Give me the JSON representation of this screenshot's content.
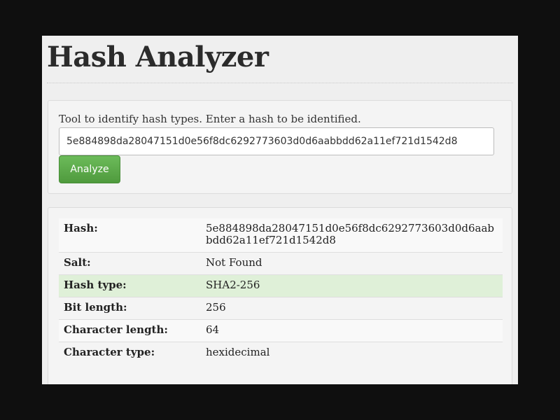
{
  "page": {
    "title": "Hash Analyzer"
  },
  "form": {
    "instructions": "Tool to identify hash types. Enter a hash to be identified.",
    "hash_value": "5e884898da28047151d0e56f8dc6292773603d0d6aabbdd62a11ef721d1542d8",
    "analyze_label": "Analyze",
    "button_color": "#5cb85c"
  },
  "result": {
    "highlight_color": "#dff0d8",
    "rows": [
      {
        "label": "Hash:",
        "value": "5e884898da28047151d0e56f8dc6292773603d0d6aabbdd62a11ef721d1542d8"
      },
      {
        "label": "Salt:",
        "value": "Not Found"
      },
      {
        "label": "Hash type:",
        "value": "SHA2-256"
      },
      {
        "label": "Bit length:",
        "value": "256"
      },
      {
        "label": "Character length:",
        "value": "64"
      },
      {
        "label": "Character type:",
        "value": "hexidecimal"
      }
    ]
  }
}
